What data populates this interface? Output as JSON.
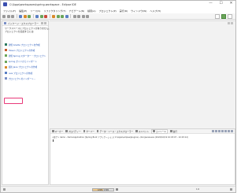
{
  "window": {
    "title": "C:\\Apps\\workspaces\\spring-workspace - Eclipse IDE",
    "minimize_label": "—",
    "maximize_label": "☐",
    "close_label": "✕"
  },
  "menu": [
    "ファイル(F)",
    "編集(E)",
    "ソース(S)",
    "リファクタリング(T)",
    "ナビゲート(N)",
    "検索(A)",
    "プロジェクト(P)",
    "実行(R)",
    "ウィンドウ(W)",
    "ヘルプ(H)"
  ],
  "package_explorer": {
    "tab_label": "パッケージ・エクスプローラー",
    "info_lines": [
      "ワークスペースにプロジェクトがありません。",
      "プロジェクトを追加するには:"
    ],
    "links": [
      {
        "label": "新規 Gradle プロジェクトを作成",
        "icon": "gradle-icon",
        "color": "#2c7a5f"
      },
      {
        "label": "Maven プロジェクトの作成",
        "icon": "maven-icon",
        "color": "#c65a2a"
      },
      {
        "label": "新規 Spring スターター・プロジェクト",
        "icon": "spring-icon",
        "color": "#6aa55a"
      },
      {
        "label": "Spring ガイドからインポート",
        "icon": "spring-guide-icon",
        "color": "#6aa55a"
      },
      {
        "label": "最新 Java プロジェクトの作成",
        "icon": "java-project-icon",
        "color": "#d98a2a"
      },
      {
        "label": "Java プロジェクトの作成",
        "icon": "java-icon",
        "color": "#5a7fc4"
      },
      {
        "label": "プロジェクトのインポート...",
        "icon": "import-icon",
        "color": "#7a8fc6"
      }
    ]
  },
  "console": {
    "tabs": [
      {
        "label": "マーカー",
        "icon": "markers-icon"
      },
      {
        "label": "プロパティー",
        "icon": "properties-icon"
      },
      {
        "label": "サーバー",
        "icon": "servers-icon"
      },
      {
        "label": "データ・ソース・エクスプローラー",
        "icon": "datasource-icon"
      },
      {
        "label": "スニペット",
        "icon": "snippets-icon"
      },
      {
        "label": "コンソール",
        "icon": "console-icon"
      },
      {
        "label": "進行",
        "icon": "progress-icon"
      }
    ],
    "active_tab": "コンソール",
    "line": "<終了> demo - DemoApplication [Spring Boot アプリケーション] C:\\Apps\\eclipse\\plugins\\...\\bin\\javaw.exe (2022/10/19 10:03:07 - 10:03:12)"
  },
  "status": {
    "heap_text": "126M / 256M",
    "heap_fraction": 0.49,
    "position_text": "1:0"
  },
  "colors": {
    "highlight": "#e8397a",
    "link": "#2457b8"
  }
}
